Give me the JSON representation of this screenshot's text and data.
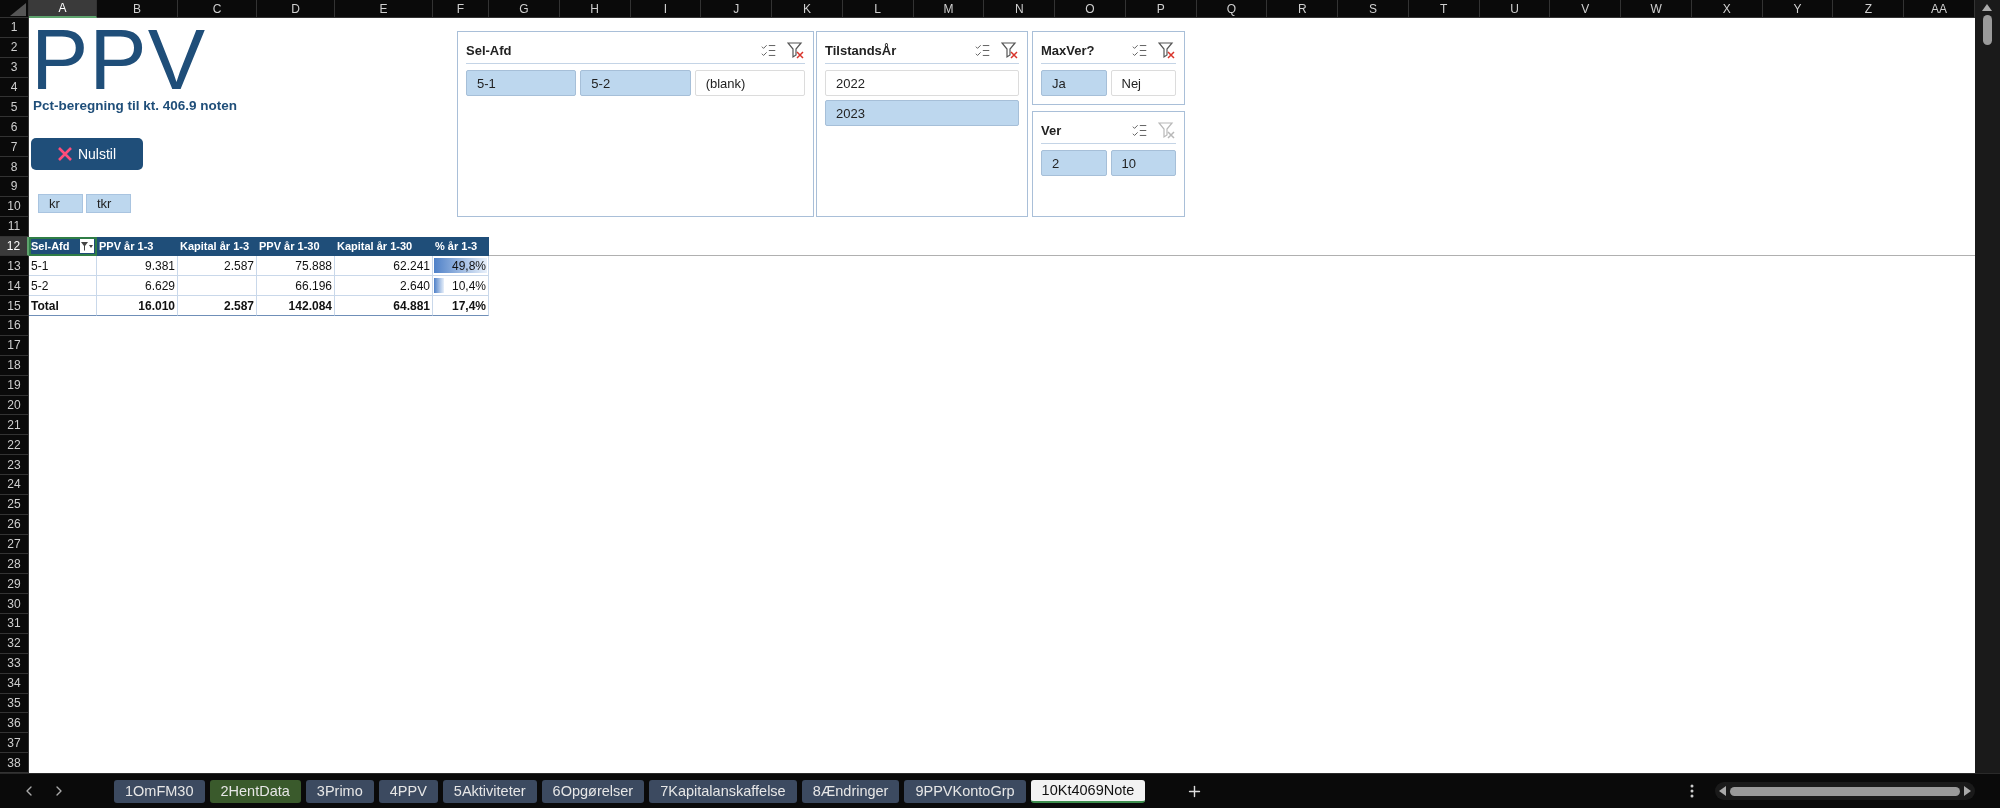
{
  "column_headers": [
    {
      "label": "A",
      "selected": true
    },
    {
      "label": "B",
      "selected": false
    },
    {
      "label": "C",
      "selected": false
    },
    {
      "label": "D",
      "selected": false
    },
    {
      "label": "E",
      "selected": false
    },
    {
      "label": "F",
      "selected": false
    },
    {
      "label": "G",
      "selected": false
    },
    {
      "label": "H",
      "selected": false
    },
    {
      "label": "I",
      "selected": false
    },
    {
      "label": "J",
      "selected": false
    },
    {
      "label": "K",
      "selected": false
    },
    {
      "label": "L",
      "selected": false
    },
    {
      "label": "M",
      "selected": false
    },
    {
      "label": "N",
      "selected": false
    },
    {
      "label": "O",
      "selected": false
    },
    {
      "label": "P",
      "selected": false
    },
    {
      "label": "Q",
      "selected": false
    },
    {
      "label": "R",
      "selected": false
    },
    {
      "label": "S",
      "selected": false
    },
    {
      "label": "T",
      "selected": false
    },
    {
      "label": "U",
      "selected": false
    },
    {
      "label": "V",
      "selected": false
    },
    {
      "label": "W",
      "selected": false
    },
    {
      "label": "X",
      "selected": false
    },
    {
      "label": "Y",
      "selected": false
    },
    {
      "label": "Z",
      "selected": false
    },
    {
      "label": "AA",
      "selected": false
    }
  ],
  "row_headers": [
    {
      "label": "1",
      "selected": false
    },
    {
      "label": "2",
      "selected": false
    },
    {
      "label": "3",
      "selected": false
    },
    {
      "label": "4",
      "selected": false
    },
    {
      "label": "5",
      "selected": false
    },
    {
      "label": "6",
      "selected": false
    },
    {
      "label": "7",
      "selected": false
    },
    {
      "label": "8",
      "selected": false
    },
    {
      "label": "9",
      "selected": false
    },
    {
      "label": "10",
      "selected": false
    },
    {
      "label": "11",
      "selected": false
    },
    {
      "label": "12",
      "selected": true
    },
    {
      "label": "13",
      "selected": false
    },
    {
      "label": "14",
      "selected": false
    },
    {
      "label": "15",
      "selected": false
    },
    {
      "label": "16",
      "selected": false
    },
    {
      "label": "17",
      "selected": false
    },
    {
      "label": "18",
      "selected": false
    },
    {
      "label": "19",
      "selected": false
    },
    {
      "label": "20",
      "selected": false
    },
    {
      "label": "21",
      "selected": false
    },
    {
      "label": "22",
      "selected": false
    },
    {
      "label": "23",
      "selected": false
    },
    {
      "label": "24",
      "selected": false
    },
    {
      "label": "25",
      "selected": false
    },
    {
      "label": "26",
      "selected": false
    },
    {
      "label": "27",
      "selected": false
    },
    {
      "label": "28",
      "selected": false
    },
    {
      "label": "29",
      "selected": false
    },
    {
      "label": "30",
      "selected": false
    },
    {
      "label": "31",
      "selected": false
    },
    {
      "label": "32",
      "selected": false
    },
    {
      "label": "33",
      "selected": false
    },
    {
      "label": "34",
      "selected": false
    },
    {
      "label": "35",
      "selected": false
    },
    {
      "label": "36",
      "selected": false
    },
    {
      "label": "37",
      "selected": false
    },
    {
      "label": "38",
      "selected": false
    }
  ],
  "title": "PPV",
  "subtitle": "Pct-beregning til kt. 406.9 noten",
  "reset_button": {
    "label": "Nulstil"
  },
  "unit_buttons": [
    {
      "label": "kr"
    },
    {
      "label": "tkr"
    }
  ],
  "pivot_table": {
    "columns": [
      {
        "label": "Sel-Afd"
      },
      {
        "label": "PPV år 1-3"
      },
      {
        "label": "Kapital år 1-3"
      },
      {
        "label": "PPV år 1-30"
      },
      {
        "label": "Kapital år 1-30"
      },
      {
        "label": "% år 1-3"
      }
    ],
    "rows": [
      {
        "kind": "data",
        "label": "5-1",
        "ppv_1_3": "9.381",
        "kapital_1_3": "2.587",
        "ppv_1_30": "75.888",
        "kapital_1_30": "62.241",
        "percent": "49,8%",
        "level": 1
      },
      {
        "kind": "data",
        "label": "5-2",
        "ppv_1_3": "6.629",
        "ppv_1_30": "66.196",
        "kapital_1_30": "2.640",
        "percent": "10,4%",
        "level": 0.21
      },
      {
        "kind": "total",
        "label": "Total",
        "ppv_1_3": "16.010",
        "kapital_1_3": "2.587",
        "ppv_1_30": "142.084",
        "kapital_1_30": "64.881",
        "percent": "17,4%"
      }
    ]
  },
  "slicers": [
    {
      "title": "Sel-Afd",
      "clear_disabled": false,
      "items": [
        {
          "label": "5-1",
          "selected": true
        },
        {
          "label": "5-2",
          "selected": true
        },
        {
          "label": "(blank)",
          "selected": false
        }
      ]
    },
    {
      "title": "TilstandsÅr",
      "clear_disabled": false,
      "items": [
        {
          "label": "2022",
          "selected": false
        },
        {
          "label": "2023",
          "selected": true
        }
      ]
    },
    {
      "title": "MaxVer?",
      "clear_disabled": false,
      "items": [
        {
          "label": "Ja",
          "selected": true
        },
        {
          "label": "Nej",
          "selected": false
        }
      ]
    },
    {
      "title": "Ver",
      "clear_disabled": true,
      "items": [
        {
          "label": "2",
          "selected": true
        },
        {
          "label": "10",
          "selected": true
        }
      ]
    }
  ],
  "sheet_tabs": [
    {
      "label": "1OmFM30",
      "selected": false,
      "color": "#3c4a60"
    },
    {
      "label": "2HentData",
      "selected": false,
      "color": "#3a5a2c"
    },
    {
      "label": "3Primo",
      "selected": false,
      "color": "#3c4a60"
    },
    {
      "label": "4PPV",
      "selected": false,
      "color": "#3c4a60"
    },
    {
      "label": "5Aktiviteter",
      "selected": false,
      "color": "#3c4a60"
    },
    {
      "label": "6Opgørelser",
      "selected": false,
      "color": "#3c4a60"
    },
    {
      "label": "7Kapitalanskaffelse",
      "selected": false,
      "color": "#3c4a60"
    },
    {
      "label": "8Ændringer",
      "selected": false,
      "color": "#3c4a60"
    },
    {
      "label": "9PPVKontoGrp",
      "selected": false,
      "color": "#3c4a60"
    },
    {
      "label": "10Kt4069Note",
      "selected": true
    }
  ]
}
